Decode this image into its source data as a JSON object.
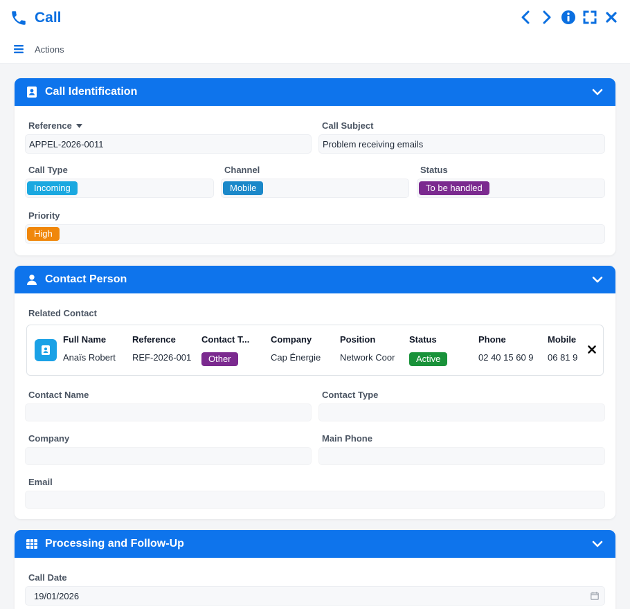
{
  "window": {
    "title": "Call",
    "actions_label": "Actions"
  },
  "sections": {
    "identification": {
      "title": "Call Identification",
      "reference_label": "Reference",
      "reference_value": "APPEL-2026-0011",
      "subject_label": "Call Subject",
      "subject_value": "Problem receiving emails",
      "call_type_label": "Call Type",
      "call_type_value": "Incoming",
      "channel_label": "Channel",
      "channel_value": "Mobile",
      "status_label": "Status",
      "status_value": "To be handled",
      "priority_label": "Priority",
      "priority_value": "High"
    },
    "contact": {
      "title": "Contact Person",
      "related_label": "Related Contact",
      "card": {
        "headers": [
          "Full Name",
          "Reference",
          "Contact T...",
          "Company",
          "Position",
          "Status",
          "Phone",
          "Mobile"
        ],
        "full_name": "Anaïs Robert",
        "reference": "REF-2026-001",
        "contact_type": "Other",
        "company": "Cap Énergie",
        "position": "Network Coor",
        "status": "Active",
        "phone": "02 40 15 60 9",
        "mobile": "06 81 9"
      },
      "contact_name_label": "Contact Name",
      "contact_name_value": "",
      "contact_type_label": "Contact Type",
      "contact_type_value": "",
      "company_label": "Company",
      "company_value": "",
      "main_phone_label": "Main Phone",
      "main_phone_value": "",
      "email_label": "Email",
      "email_value": ""
    },
    "processing": {
      "title": "Processing and Follow-Up",
      "call_date_label": "Call Date",
      "call_date_value": "19/01/2026"
    }
  },
  "colors": {
    "brand": "#0e74ec",
    "incoming": "#1aa8e0",
    "mobile": "#1b88c9",
    "to_be_handled": "#7b2a8f",
    "high": "#f0870b",
    "other": "#7b2a8f",
    "active": "#19923a"
  },
  "icons": [
    "phone-icon",
    "chevron-left-icon",
    "chevron-right-icon",
    "info-icon",
    "expand-icon",
    "close-icon",
    "menu-icon",
    "contact-card-icon",
    "user-icon",
    "table-icon",
    "chevron-down-icon",
    "calendar-icon"
  ]
}
